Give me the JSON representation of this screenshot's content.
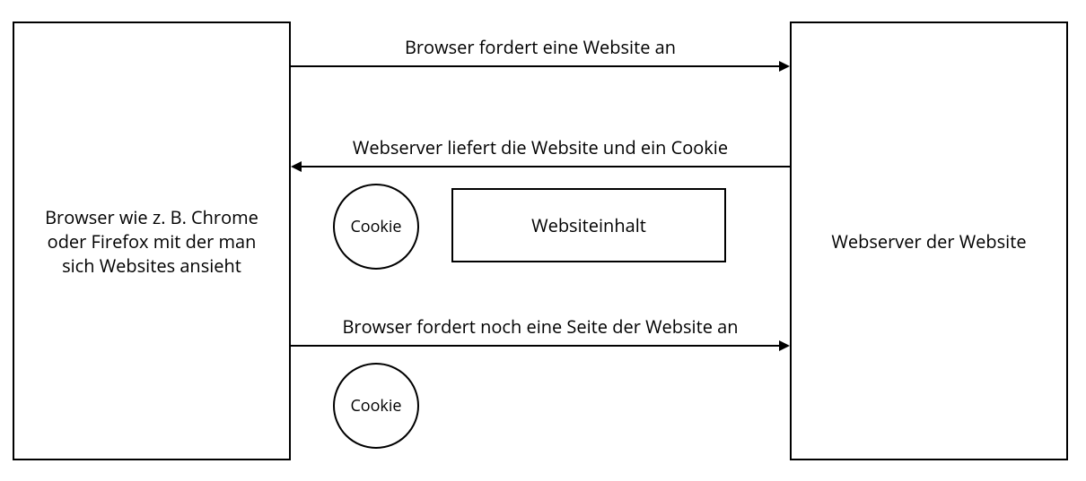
{
  "browser": {
    "label": "Browser wie z. B. Chrome oder Firefox mit der man sich Websites ansieht"
  },
  "server": {
    "label": "Webserver der Website"
  },
  "flows": {
    "request1": {
      "label": "Browser fordert eine Website an"
    },
    "response": {
      "label": "Webserver liefert die Website und ein Cookie",
      "cookie_label": "Cookie",
      "content_label": "Websiteinhalt"
    },
    "request2": {
      "label": "Browser fordert noch eine Seite der Website an",
      "cookie_label": "Cookie"
    }
  },
  "colors": {
    "stroke": "#000000",
    "bg": "#ffffff"
  }
}
